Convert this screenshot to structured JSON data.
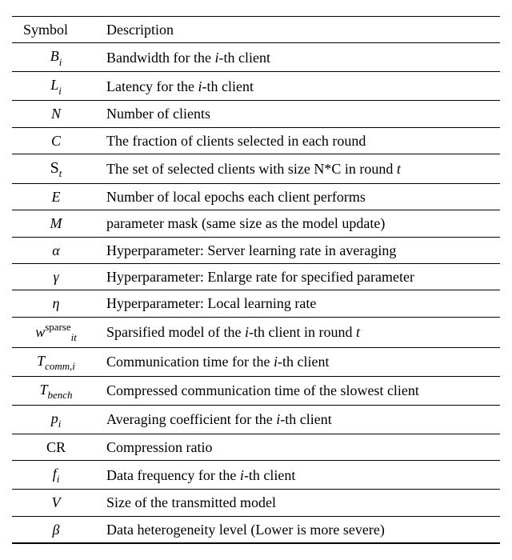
{
  "chart_data": {
    "type": "table",
    "title": "",
    "columns": [
      "Symbol",
      "Description"
    ],
    "rows": [
      {
        "symbol_html": "B<span class='sub'>i</span>",
        "desc": "Bandwidth for the <i>i</i>-th client"
      },
      {
        "symbol_html": "L<span class='sub'>i</span>",
        "desc": "Latency for the <i>i</i>-th client"
      },
      {
        "symbol_html": "N",
        "desc": "Number of clients"
      },
      {
        "symbol_html": "C",
        "desc": "The fraction of clients selected in each round"
      },
      {
        "symbol_html": "<span class='cal'>S</span><span class='sub'>t</span>",
        "desc": "The set of selected clients with size N*C in round <i>t</i>"
      },
      {
        "symbol_html": "E",
        "desc": "Number of local epochs each client performs"
      },
      {
        "symbol_html": "M",
        "desc": "parameter mask (same size as the model update)"
      },
      {
        "symbol_html": "&alpha;",
        "desc": "Hyperparameter: Server learning rate in averaging"
      },
      {
        "symbol_html": "&gamma;",
        "desc": "Hyperparameter: Enlarge rate for specified parameter"
      },
      {
        "symbol_html": "&eta;",
        "desc": "Hyperparameter: Local learning rate"
      },
      {
        "symbol_html": "w<span class='sup upright'>sparse</span><span class='sub'>it</span>",
        "desc": "Sparsified model of the <i>i</i>-th client in round <i>t</i>"
      },
      {
        "symbol_html": "T<span class='sub'>comm,i</span>",
        "desc": "Communication time for the <i>i</i>-th client"
      },
      {
        "symbol_html": "T<span class='sub'>bench</span>",
        "desc": "Compressed communication time of the slowest client"
      },
      {
        "symbol_html": "p<span class='sub'>i</span>",
        "desc": "Averaging coefficient for the <i>i</i>-th client"
      },
      {
        "symbol_html": "<span class='upright'>CR</span>",
        "desc": "Compression ratio"
      },
      {
        "symbol_html": "f<span class='sub'>i</span>",
        "desc": "Data frequency for the <i>i</i>-th client"
      },
      {
        "symbol_html": "V",
        "desc": "Size of the transmitted model"
      },
      {
        "symbol_html": "&beta;",
        "desc": "Data heterogeneity level (Lower is more severe)"
      }
    ]
  },
  "header": {
    "symbol": "Symbol",
    "description": "Description"
  }
}
